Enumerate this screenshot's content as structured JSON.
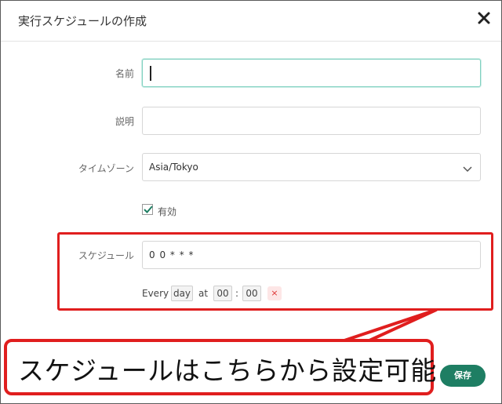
{
  "dialog": {
    "title": "実行スケジュールの作成",
    "close_icon": "close-icon"
  },
  "form": {
    "name": {
      "label": "名前",
      "value": ""
    },
    "description": {
      "label": "説明",
      "value": ""
    },
    "timezone": {
      "label": "タイムゾーン",
      "value": "Asia/Tokyo"
    },
    "enabled": {
      "label": "有効",
      "checked": true
    },
    "schedule": {
      "label": "スケジュール",
      "value": "0 0 * * *",
      "every_label": "Every",
      "unit": "day",
      "at_label": "at",
      "hour": "00",
      "separator": ":",
      "minute": "00",
      "clear_icon": "×"
    }
  },
  "callout": {
    "text": "スケジュールはこちらから設定可能"
  },
  "footer": {
    "save_label": "保存"
  },
  "colors": {
    "accent": "#1e7e63",
    "annotation": "#e01e1e",
    "focus_border": "#7fd0c0"
  }
}
